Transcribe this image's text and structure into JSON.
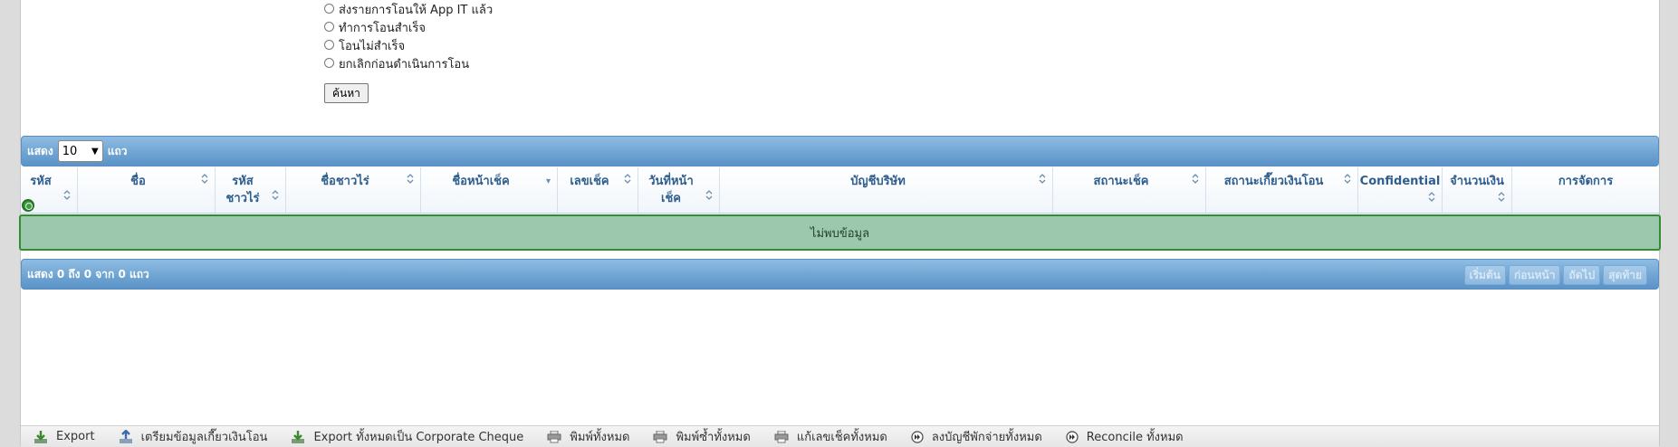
{
  "filters": {
    "status_options": [
      "ส่งรายการโอนให้ App IT แล้ว",
      "ทำการโอนสำเร็จ",
      "โอนไม่สำเร็จ",
      "ยกเลิกก่อนดำเนินการโอน"
    ],
    "search_label": "ค้นหา"
  },
  "table": {
    "length_prefix": "แสดง",
    "length_value": "10",
    "length_suffix": "แถว",
    "columns": [
      {
        "label": "รหัส",
        "sort": "both"
      },
      {
        "label": "ชื่อ",
        "sort": "both"
      },
      {
        "label": "รหัส ชาวไร่",
        "sort": "both"
      },
      {
        "label": "ชื่อชาวไร่",
        "sort": "both"
      },
      {
        "label": "ชื่อหน้าเช็ค",
        "sort": "desc"
      },
      {
        "label": "เลขเช็ค",
        "sort": "both"
      },
      {
        "label": "วันที่หน้า เช็ค",
        "sort": "both"
      },
      {
        "label": "บัญชีบริษัท",
        "sort": "both"
      },
      {
        "label": "สถานะเช็ค",
        "sort": "both"
      },
      {
        "label": "สถานะเกี๊ยวเงินโอน",
        "sort": "both"
      },
      {
        "label": "Confidential",
        "sort": "both"
      },
      {
        "label": "จำนวนเงิน",
        "sort": "both"
      },
      {
        "label": "การจัดการ",
        "sort": "none"
      }
    ],
    "empty_message": "ไม่พบข้อมูล",
    "info": "แสดง 0 ถึง 0 จาก 0 แถว",
    "pager": [
      "เริ่มต้น",
      "ก่อนหน้า",
      "ถัดไป",
      "สุดท้าย"
    ]
  },
  "toolbar": {
    "items": [
      {
        "label": "Export",
        "icon": "export-icon"
      },
      {
        "label": "เตรียมข้อมูลเกี๊ยวเงินโอน",
        "icon": "upload-icon"
      },
      {
        "label": "Export ทั้งหมดเป็น Corporate Cheque",
        "icon": "export-icon"
      },
      {
        "label": "พิมพ์ทั้งหมด",
        "icon": "printer-icon"
      },
      {
        "label": "พิมพ์ซ้ำทั้งหมด",
        "icon": "printer-icon"
      },
      {
        "label": "แก้เลขเช็คทั้งหมด",
        "icon": "printer-icon"
      },
      {
        "label": "ลงบัญชีพักจ่ายทั้งหมด",
        "icon": "forward-icon"
      },
      {
        "label": "Reconcile ทั้งหมด",
        "icon": "forward-icon"
      }
    ]
  },
  "colors": {
    "bar_blue": "#6fa5d3",
    "header_text": "#2e5e8e",
    "empty_row_bg": "#9cc9ae",
    "empty_row_border": "#2f8f2f"
  }
}
